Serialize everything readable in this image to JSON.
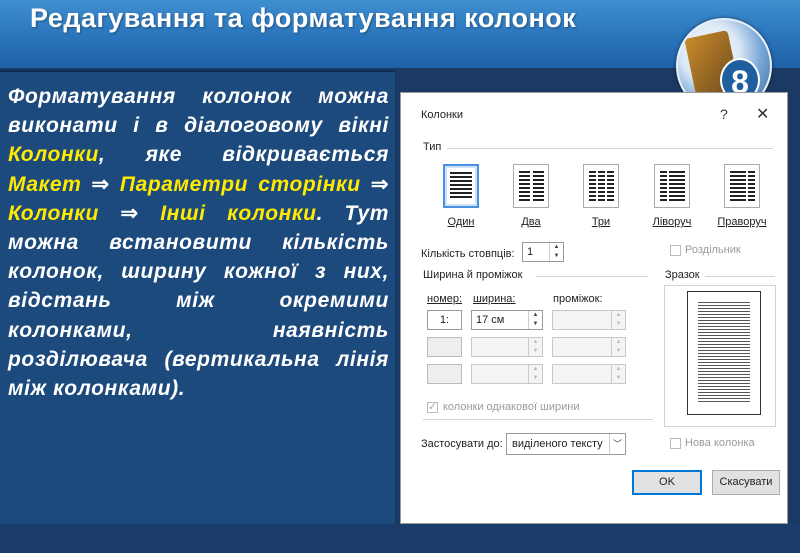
{
  "slide": {
    "title": "Редагування та форматування колонок",
    "logo_number": "8"
  },
  "body": {
    "t1": "Форматування колонок можна виконати і в діалоговому вікні ",
    "t2": "Колонки",
    "t3": ", яке відкривається ",
    "t4": "Макет",
    "arrow": "⇒",
    "t5": "Параметри сторінки",
    "t6": "Колонки",
    "t7": "Інші колонки",
    "t8": ". Тут можна встановити кількість колонок, ширину кожної з них, відстань між окремими колонками, наявність розділювача (вертикальна лінія між колонками)."
  },
  "dialog": {
    "title": "Колонки",
    "help": "?",
    "close": "✕",
    "type_label": "Тип",
    "presets": [
      "Один",
      "Два",
      "Три",
      "Ліворуч",
      "Праворуч"
    ],
    "selected_preset": "Один",
    "count_label": "Кількість стовпців:",
    "count_value": "1",
    "separator_label": "Роздільник",
    "width_group_label": "Ширина й проміжок",
    "col_number_label": "номер:",
    "col_width_label": "ширина:",
    "col_spacing_label": "проміжок:",
    "row1_number": "1:",
    "row1_width": "17 см",
    "equal_width_label": "колонки однакової ширини",
    "preview_label": "Зразок",
    "apply_label": "Застосувати до:",
    "apply_value": "виділеного тексту",
    "new_column_label": "Нова колонка",
    "ok_label": "OK",
    "cancel_label": "Скасувати"
  },
  "colors": {
    "highlight": "#ffea00",
    "header_blue": "#2a74bb",
    "panel_blue": "#1d4a7c",
    "focus_blue": "#0078d7"
  }
}
